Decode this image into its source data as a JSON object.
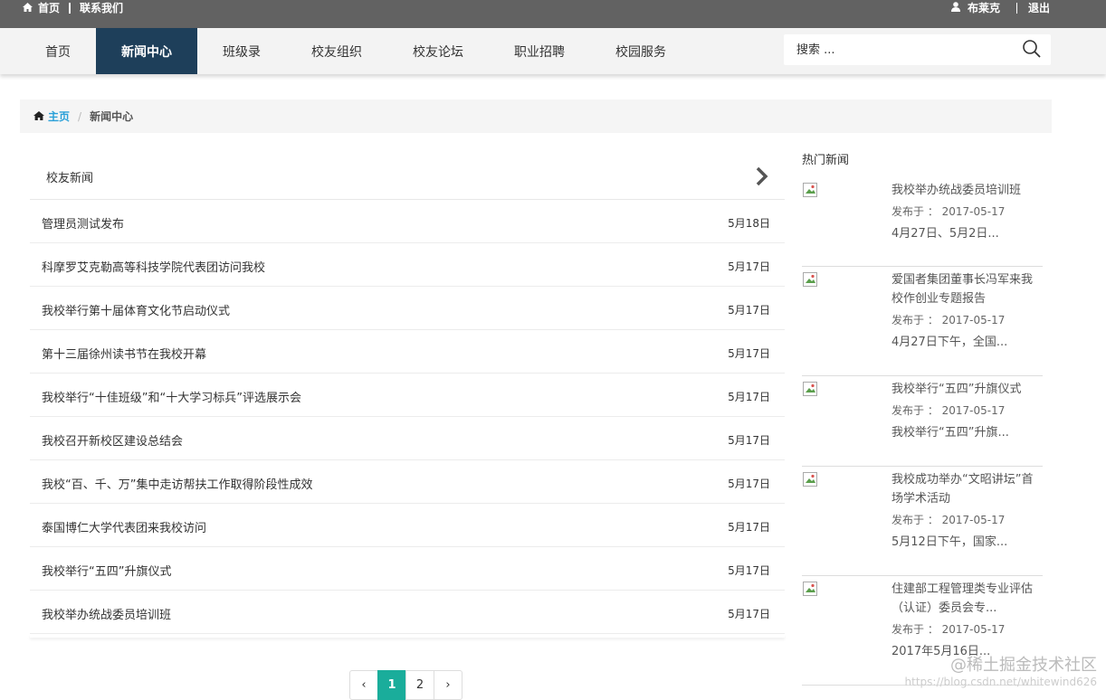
{
  "topbar": {
    "home": "首页",
    "contact": "联系我们",
    "user": "布莱克",
    "logout": "退出"
  },
  "nav": {
    "items": [
      "首页",
      "新闻中心",
      "班级录",
      "校友组织",
      "校友论坛",
      "职业招聘",
      "校园服务"
    ],
    "active_index": 1,
    "search_placeholder": "搜索 ..."
  },
  "breadcrumb": {
    "home": "主页",
    "current": "新闻中心"
  },
  "list": {
    "title": "校友新闻",
    "rows": [
      {
        "title": "管理员测试发布",
        "date": "5月18日"
      },
      {
        "title": "科摩罗艾克勒高等科技学院代表团访问我校",
        "date": "5月17日"
      },
      {
        "title": "我校举行第十届体育文化节启动仪式",
        "date": "5月17日"
      },
      {
        "title": "第十三届徐州读书节在我校开幕",
        "date": "5月17日"
      },
      {
        "title": "我校举行“十佳班级”和“十大学习标兵”评选展示会",
        "date": "5月17日"
      },
      {
        "title": "我校召开新校区建设总结会",
        "date": "5月17日"
      },
      {
        "title": "我校“百、千、万”集中走访帮扶工作取得阶段性成效",
        "date": "5月17日"
      },
      {
        "title": "泰国博仁大学代表团来我校访问",
        "date": "5月17日"
      },
      {
        "title": "我校举行“五四”升旗仪式",
        "date": "5月17日"
      },
      {
        "title": "我校举办统战委员培训班",
        "date": "5月17日"
      }
    ]
  },
  "pager": {
    "prev": "‹",
    "pages": [
      "1",
      "2"
    ],
    "active_page": "1",
    "next": "›"
  },
  "hot": {
    "title": "热门新闻",
    "items": [
      {
        "title": "我校举办统战委员培训班",
        "meta": "发布于 ： 2017-05-17",
        "excerpt": "4月27日、5月2日..."
      },
      {
        "title": "爱国者集团董事长冯军来我校作创业专题报告",
        "meta": "发布于 ： 2017-05-17",
        "excerpt": "4月27日下午，全国..."
      },
      {
        "title": "我校举行“五四”升旗仪式",
        "meta": "发布于 ： 2017-05-17",
        "excerpt": "我校举行“五四”升旗..."
      },
      {
        "title": "我校成功举办“文昭讲坛”首场学术活动",
        "meta": "发布于 ： 2017-05-17",
        "excerpt": "5月12日下午，国家..."
      },
      {
        "title": "住建部工程管理类专业评估（认证）委员会专...",
        "meta": "发布于 ： 2017-05-17",
        "excerpt": "2017年5月16日..."
      }
    ]
  },
  "watermark": {
    "line1": "@稀土掘金技术社区",
    "line2": "https://blog.csdn.net/whitewind626"
  },
  "colors": {
    "topbar": "#626262",
    "nav_active": "#1e3f5a",
    "link": "#2aa0d8",
    "pager_active": "#1aad9b"
  }
}
